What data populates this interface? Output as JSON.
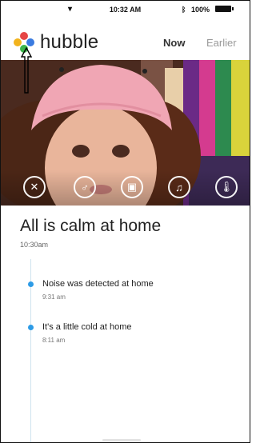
{
  "status_bar": {
    "time": "10:32 AM",
    "battery_pct": "100%"
  },
  "header": {
    "brand": "hubble",
    "tabs": [
      {
        "label": "Now",
        "active": true
      },
      {
        "label": "Earlier",
        "active": false
      }
    ]
  },
  "video_controls": [
    {
      "icon": "pan-tilt-icon"
    },
    {
      "icon": "microphone-icon"
    },
    {
      "icon": "camera-icon"
    },
    {
      "icon": "music-icon"
    },
    {
      "icon": "thermometer-icon"
    }
  ],
  "main": {
    "title": "All is calm at home",
    "time": "10:30am"
  },
  "events": [
    {
      "title": "Noise was detected at home",
      "time": "9:31 am"
    },
    {
      "title": "It's a little cold at home",
      "time": "8:11 am"
    }
  ],
  "colors": {
    "accent": "#2d9be6",
    "tab_active": "#333333",
    "tab_inactive": "#9a9a9a"
  }
}
